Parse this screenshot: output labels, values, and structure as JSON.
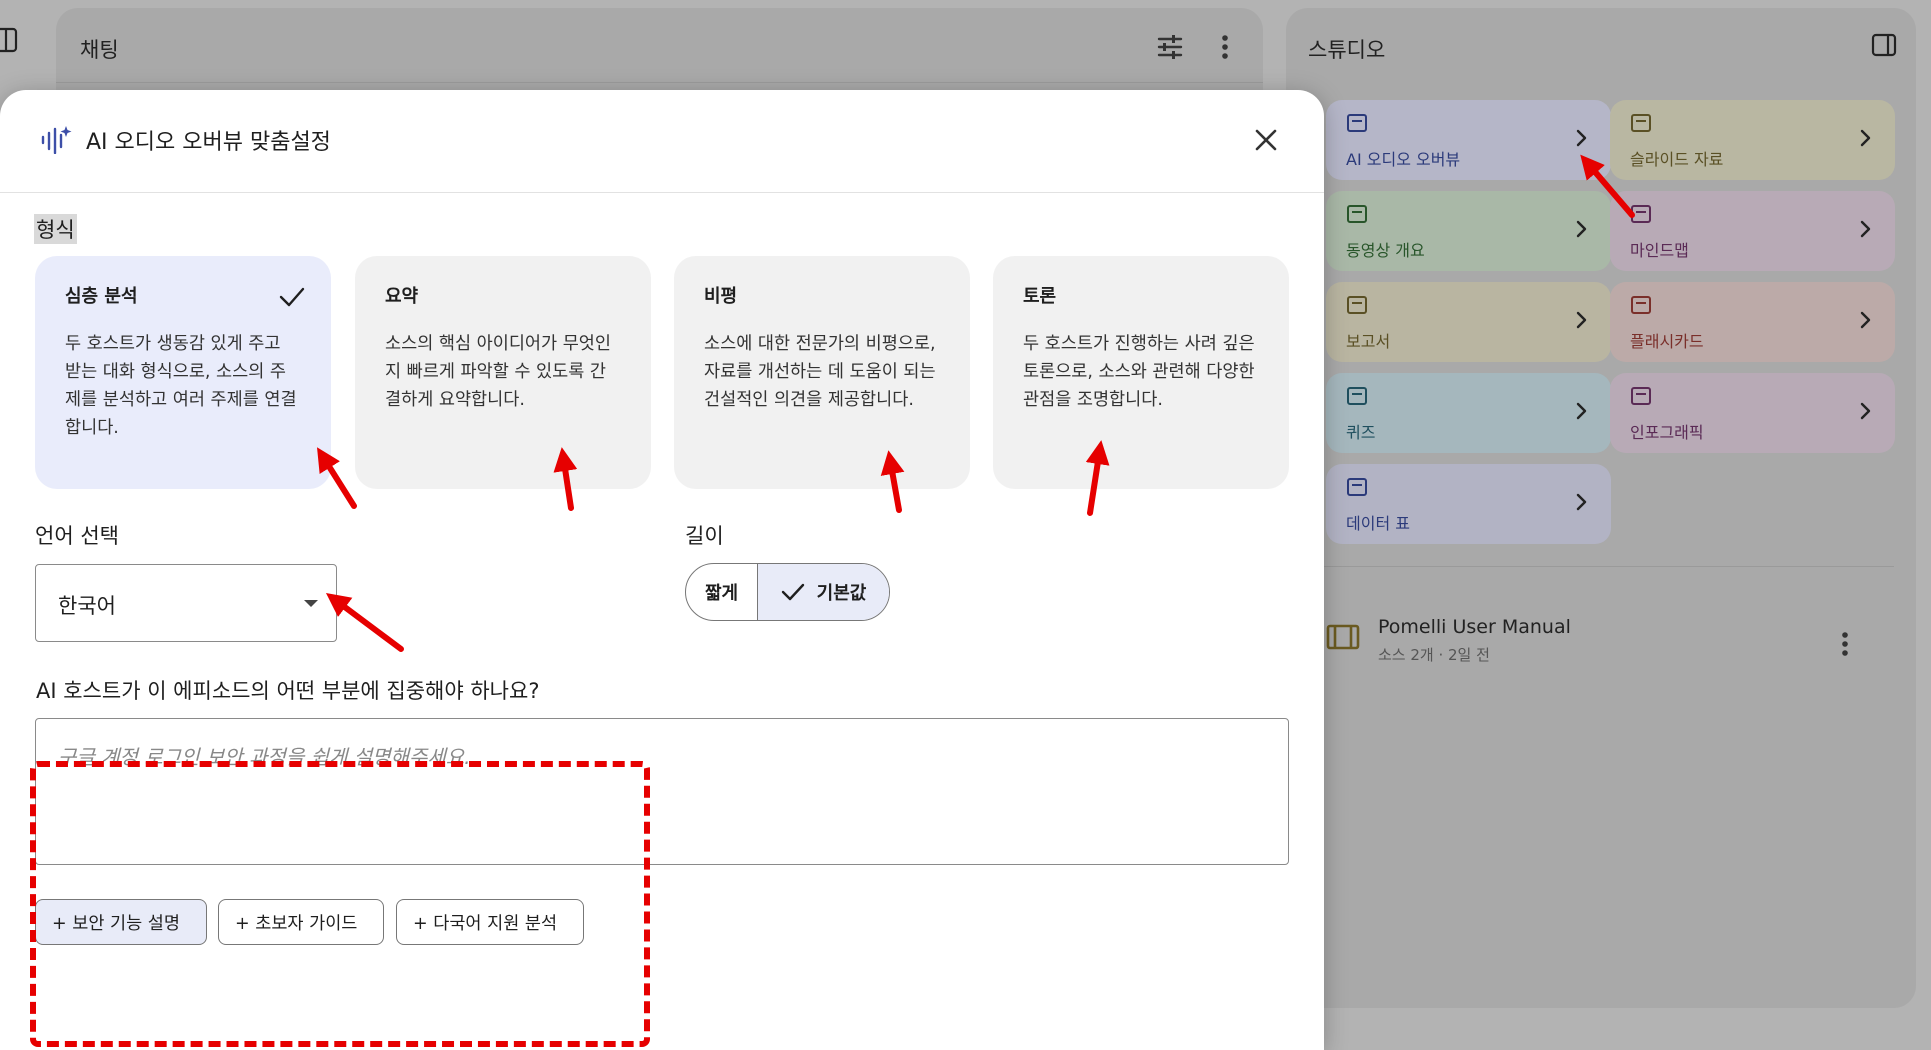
{
  "chat": {
    "title": "채팅"
  },
  "studio": {
    "title": "스튜디오",
    "tiles": [
      {
        "label": "AI 오디오 오버뷰",
        "icon": "audio-spark-icon",
        "color": "#b5b6c8"
      },
      {
        "label": "슬라이드 자료",
        "icon": "slides-icon",
        "color": "#b9b7a2"
      },
      {
        "label": "동영상 개요",
        "icon": "video-icon",
        "color": "#a9b8a7"
      },
      {
        "label": "마인드맵",
        "icon": "mindmap-icon",
        "color": "#b8aab6"
      },
      {
        "label": "보고서",
        "icon": "report-icon",
        "color": "#b9b5a1"
      },
      {
        "label": "플래시카드",
        "icon": "flashcard-icon",
        "color": "#bcaaa8"
      },
      {
        "label": "퀴즈",
        "icon": "quiz-icon",
        "color": "#a5b7bd"
      },
      {
        "label": "인포그래픽",
        "icon": "infographic-icon",
        "color": "#b8aab6"
      },
      {
        "label": "데이터 표",
        "icon": "table-icon",
        "color": "#b2b3c4"
      }
    ],
    "source": {
      "title": "Pomelli User Manual",
      "meta": "소스 2개 · 2일 전"
    }
  },
  "modal": {
    "title": "AI 오디오 오버뷰 맞춤설정",
    "format_label": "형식",
    "formats": [
      {
        "title": "심층 분석",
        "desc": "두 호스트가 생동감 있게 주고 받는 대화 형식으로, 소스의 주제를 분석하고 여러 주제를 연결합니다.",
        "selected": true
      },
      {
        "title": "요약",
        "desc": "소스의 핵심 아이디어가 무엇인지 빠르게 파악할 수 있도록 간결하게 요약합니다.",
        "selected": false
      },
      {
        "title": "비평",
        "desc": "소스에 대한 전문가의 비평으로, 자료를 개선하는 데 도움이 되는 건설적인 의견을 제공합니다.",
        "selected": false
      },
      {
        "title": "토론",
        "desc": "두 호스트가 진행하는 사려 깊은 토론으로, 소스와 관련해 다양한 관점을 조명합니다.",
        "selected": false
      }
    ],
    "language_label": "언어 선택",
    "language_value": "한국어",
    "length_label": "길이",
    "length_options": {
      "short": "짧게",
      "default": "기본값"
    },
    "focus_label": "AI 호스트가 이 에피소드의 어떤 부분에 집중해야 하나요?",
    "focus_placeholder": "구글 계정 로그인 보안 과정을 쉽게 설명해주세요.",
    "chips": [
      "+ 보안 기능 설명",
      "+ 초보자 가이드",
      "+ 다국어 지원 분석"
    ]
  },
  "colors": {
    "annotation": "#e60000",
    "selected_card": "#e9ecfb",
    "accent": "#3d4fa8"
  }
}
